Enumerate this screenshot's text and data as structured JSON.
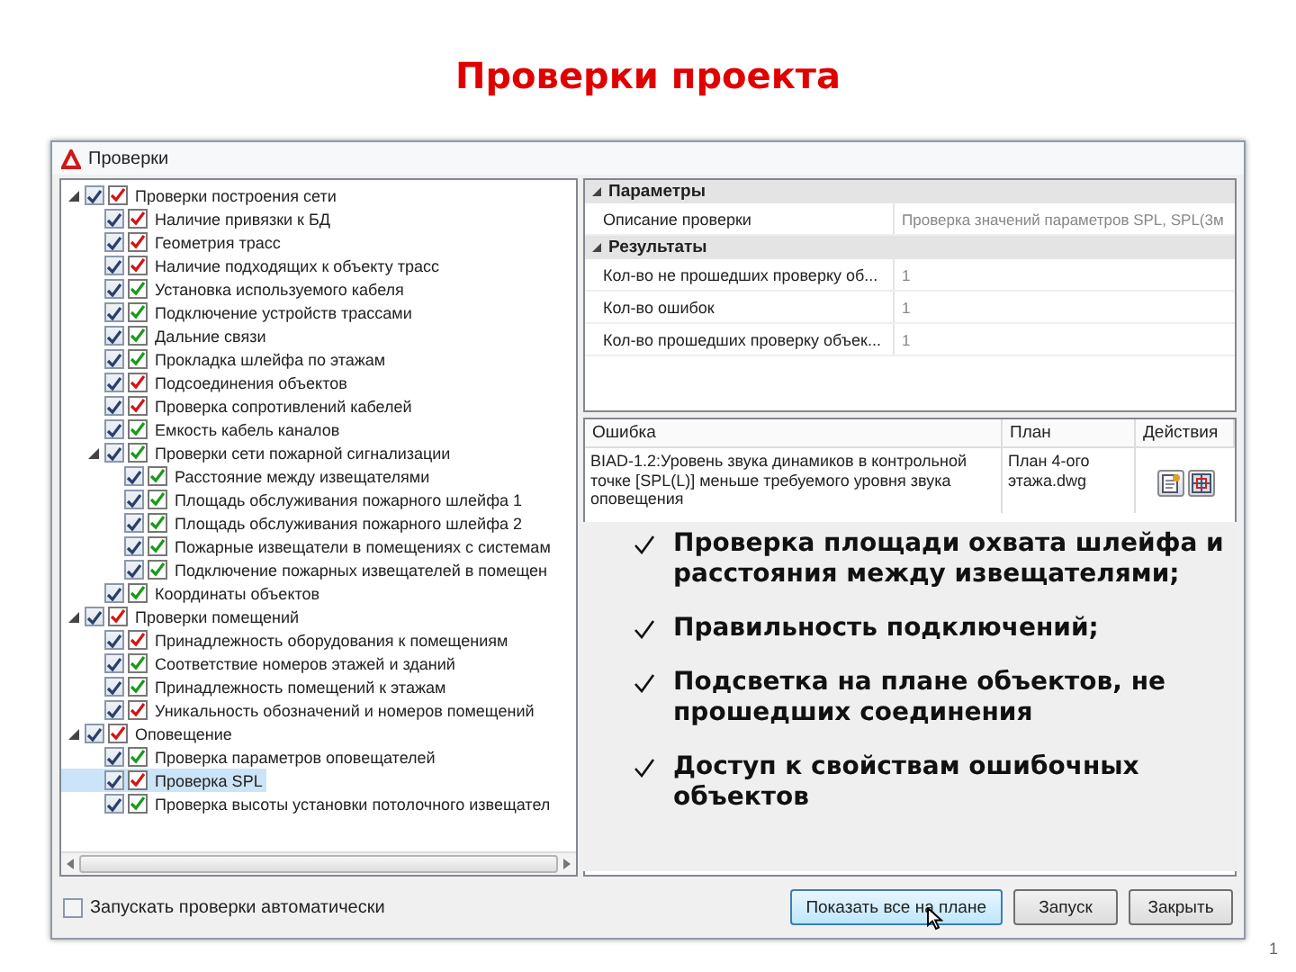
{
  "slide": {
    "title": "Проверки проекта",
    "slide_number": "1"
  },
  "window": {
    "title": "Проверки"
  },
  "tree": [
    {
      "label": "Проверки построения сети",
      "checked": true,
      "color": "#d41414",
      "selected": false,
      "expanded": true,
      "children": [
        {
          "label": "Наличие привязки к БД",
          "checked": true,
          "color": "#d41414",
          "selected": false
        },
        {
          "label": "Геометрия трасс",
          "checked": true,
          "color": "#d41414",
          "selected": false
        },
        {
          "label": "Наличие подходящих к объекту трасс",
          "checked": true,
          "color": "#d41414",
          "selected": false
        },
        {
          "label": "Установка используемого кабеля",
          "checked": true,
          "color": "#1a9a1a",
          "selected": false
        },
        {
          "label": "Подключение устройств трассами",
          "checked": true,
          "color": "#1a9a1a",
          "selected": false
        },
        {
          "label": "Дальние связи",
          "checked": true,
          "color": "#1a9a1a",
          "selected": false
        },
        {
          "label": "Прокладка шлейфа по этажам",
          "checked": true,
          "color": "#1a9a1a",
          "selected": false
        },
        {
          "label": "Подсоединения объектов",
          "checked": true,
          "color": "#d41414",
          "selected": false
        },
        {
          "label": "Проверка сопротивлений кабелей",
          "checked": true,
          "color": "#d41414",
          "selected": false
        },
        {
          "label": "Емкость кабель каналов",
          "checked": true,
          "color": "#1a9a1a",
          "selected": false
        },
        {
          "label": "Проверки сети пожарной сигнализации",
          "checked": true,
          "color": "#1a9a1a",
          "selected": false,
          "expanded": true,
          "children": [
            {
              "label": "Расстояние между извещателями",
              "checked": true,
              "color": "#1a9a1a",
              "selected": false
            },
            {
              "label": "Площадь обслуживания пожарного шлейфа 1",
              "checked": true,
              "color": "#1a9a1a",
              "selected": false
            },
            {
              "label": "Площадь обслуживания пожарного шлейфа 2",
              "checked": true,
              "color": "#1a9a1a",
              "selected": false
            },
            {
              "label": "Пожарные извещатели в помещениях с системам",
              "checked": true,
              "color": "#1a9a1a",
              "selected": false
            },
            {
              "label": "Подключение пожарных извещателей в помещен",
              "checked": true,
              "color": "#1a9a1a",
              "selected": false
            }
          ]
        },
        {
          "label": "Координаты объектов",
          "checked": true,
          "color": "#1a9a1a",
          "selected": false
        }
      ]
    },
    {
      "label": "Проверки помещений",
      "checked": true,
      "color": "#d41414",
      "selected": false,
      "expanded": true,
      "children": [
        {
          "label": "Принадлежность оборудования к помещениям",
          "checked": true,
          "color": "#d41414",
          "selected": false
        },
        {
          "label": "Соответствие номеров этажей и зданий",
          "checked": true,
          "color": "#1a9a1a",
          "selected": false
        },
        {
          "label": "Принадлежность помещений к этажам",
          "checked": true,
          "color": "#1a9a1a",
          "selected": false
        },
        {
          "label": "Уникальность обозначений и номеров помещений",
          "checked": true,
          "color": "#d41414",
          "selected": false
        }
      ]
    },
    {
      "label": "Оповещение",
      "checked": true,
      "color": "#d41414",
      "selected": false,
      "expanded": true,
      "children": [
        {
          "label": "Проверка параметров оповещателей",
          "checked": true,
          "color": "#1a9a1a",
          "selected": false
        },
        {
          "label": "Проверка SPL",
          "checked": true,
          "color": "#d41414",
          "selected": true
        },
        {
          "label": "Проверка высоты установки потолочного извещател",
          "checked": true,
          "color": "#1a9a1a",
          "selected": false
        }
      ]
    }
  ],
  "properties": [
    {
      "name": "Параметры",
      "expanded": true,
      "rows": [
        {
          "name": "Описание проверки",
          "value": "Проверка значений параметров SPL, SPL(3м"
        }
      ]
    },
    {
      "name": "Результаты",
      "expanded": true,
      "rows": [
        {
          "name": "Кол-во не прошедших проверку об...",
          "value": "1"
        },
        {
          "name": "Кол-во ошибок",
          "value": "1"
        },
        {
          "name": "Кол-во прошедших проверку объек...",
          "value": "1"
        }
      ]
    }
  ],
  "errors": {
    "columns": [
      "Ошибка",
      "План",
      "Действия"
    ],
    "rows": [
      {
        "error": "BIAD-1.2:Уровень звука динамиков в контрольной точке [SPL(L)] меньше требуемого уровня звука оповещения",
        "plan": "План 4-ого этажа.dwg"
      }
    ]
  },
  "auto_run": {
    "label": "Запускать проверки автоматически",
    "checked": false
  },
  "buttons": [
    {
      "label": "Показать все на плане",
      "selected": true
    },
    {
      "label": "Запуск",
      "selected": false
    },
    {
      "label": "Закрыть",
      "selected": false
    }
  ],
  "bullets": [
    "Проверка площади охвата шлейфа и расстояния между извещателями;",
    "Правильность подключений;",
    "Подсветка на плане объектов, не прошедших соединения",
    "Доступ к свойствам ошибочных объектов"
  ]
}
